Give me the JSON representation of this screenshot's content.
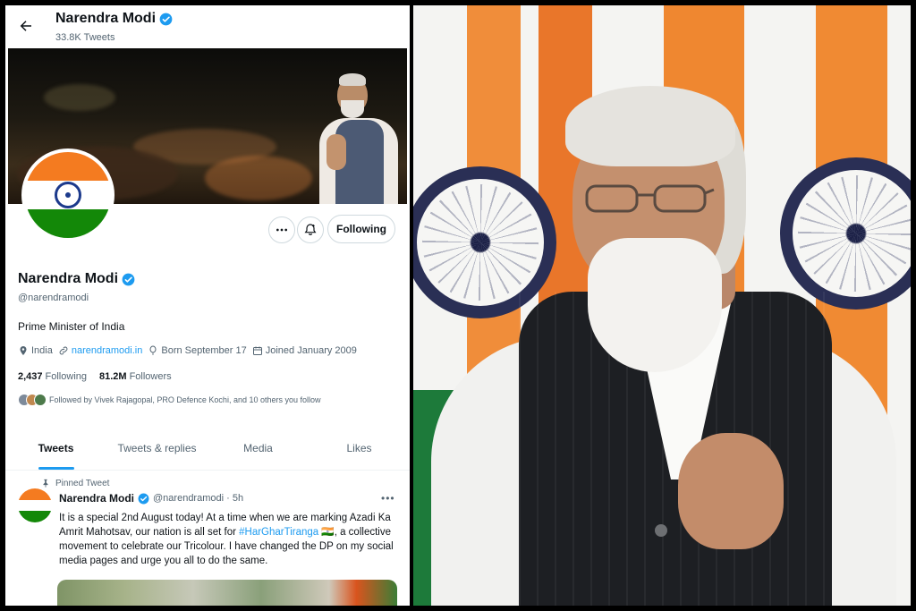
{
  "header": {
    "name": "Narendra Modi",
    "tweet_count": "33.8K Tweets"
  },
  "profile": {
    "name": "Narendra Modi",
    "handle": "@narendramodi",
    "bio": "Prime Minister of India",
    "location": "India",
    "website": "narendramodi.in",
    "born": "Born September 17",
    "joined": "Joined January 2009",
    "following_count": "2,437",
    "following_label": "Following",
    "followers_count": "81.2M",
    "followers_label": "Followers",
    "followed_by": "Followed by Vivek Rajagopal, PRO Defence Kochi, and 10 others you follow"
  },
  "actions": {
    "follow_label": "Following"
  },
  "tabs": [
    {
      "label": "Tweets"
    },
    {
      "label": "Tweets & replies"
    },
    {
      "label": "Media"
    },
    {
      "label": "Likes"
    }
  ],
  "tweet": {
    "pinned_label": "Pinned Tweet",
    "author": "Narendra Modi",
    "handle_time": "@narendramodi · 5h",
    "text_before": "It is a special 2nd August today! At a time when we are marking Azadi Ka Amrit Mahotsav, our nation is all set for ",
    "hashtag": "#HarGharTiranga",
    "text_after": " 🇮🇳, a collective movement to celebrate our Tricolour. I have changed the DP on my social media pages and urge you all to do the same.",
    "more": "•••"
  },
  "colors": {
    "accent": "#1d9bf0",
    "saffron": "#f47b20",
    "green": "#138808",
    "navy": "#1c3a8c"
  },
  "icons": {
    "back": "arrow-left-icon",
    "verified": "verified-badge-icon",
    "location": "location-pin-icon",
    "link": "link-icon",
    "birthday": "balloon-icon",
    "calendar": "calendar-icon",
    "more": "more-horizontal-icon",
    "notify": "bell-plus-icon",
    "pin": "pin-icon"
  }
}
